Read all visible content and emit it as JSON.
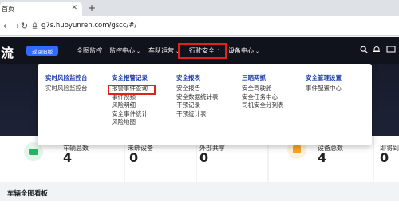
{
  "browser": {
    "tab_title": "首页",
    "close_symbol": "✕",
    "new_tab_symbol": "+",
    "back_symbol": "←",
    "forward_symbol": "→",
    "reload_symbol": "↻",
    "url": "g7s.huoyunren.com/gscc/#/"
  },
  "header": {
    "brand": "流",
    "back_button": "返回旧版",
    "menu": [
      {
        "label": "全图监控",
        "has_caret": false
      },
      {
        "label": "监控中心",
        "has_caret": true
      },
      {
        "label": "车队运营",
        "has_caret": true
      },
      {
        "label": "行驶安全",
        "has_caret": true
      },
      {
        "label": "设备中心",
        "has_caret": true
      }
    ],
    "caret_down": "⌄",
    "caret_up": "⌃"
  },
  "dropdown": {
    "columns": [
      {
        "heading": "实时风险监控台",
        "items": [
          "实时风险监控台"
        ]
      },
      {
        "heading": "安全报警记录",
        "items": [
          "报警事件查询",
          "事件视频",
          "风险明细",
          "安全事件统计",
          "风险地图"
        ]
      },
      {
        "heading": "安全报表",
        "items": [
          "安全报告",
          "安全数据统计表",
          "干预记录",
          "干预统计表"
        ]
      },
      {
        "heading": "三晒两抓",
        "items": [
          "安全驾驶舱",
          "安全任务中心",
          "司机安全分列表"
        ]
      },
      {
        "heading": "安全管理设置",
        "items": [
          "事件配置中心"
        ]
      }
    ]
  },
  "stats": [
    {
      "label": "车辆总数",
      "value": "4"
    },
    {
      "label": "未绑设备",
      "value": "0"
    },
    {
      "label": "外部共享",
      "value": "0"
    },
    {
      "label": "设备总数",
      "value": "4"
    },
    {
      "label": "即将到",
      "value": "0"
    }
  ],
  "section": {
    "title": "车辆全图看板"
  },
  "colors": {
    "accent": "#2f6bff",
    "header_bg": "#10131c",
    "highlight": "#e0221b",
    "dropdown_heading": "#1f3ea8"
  }
}
